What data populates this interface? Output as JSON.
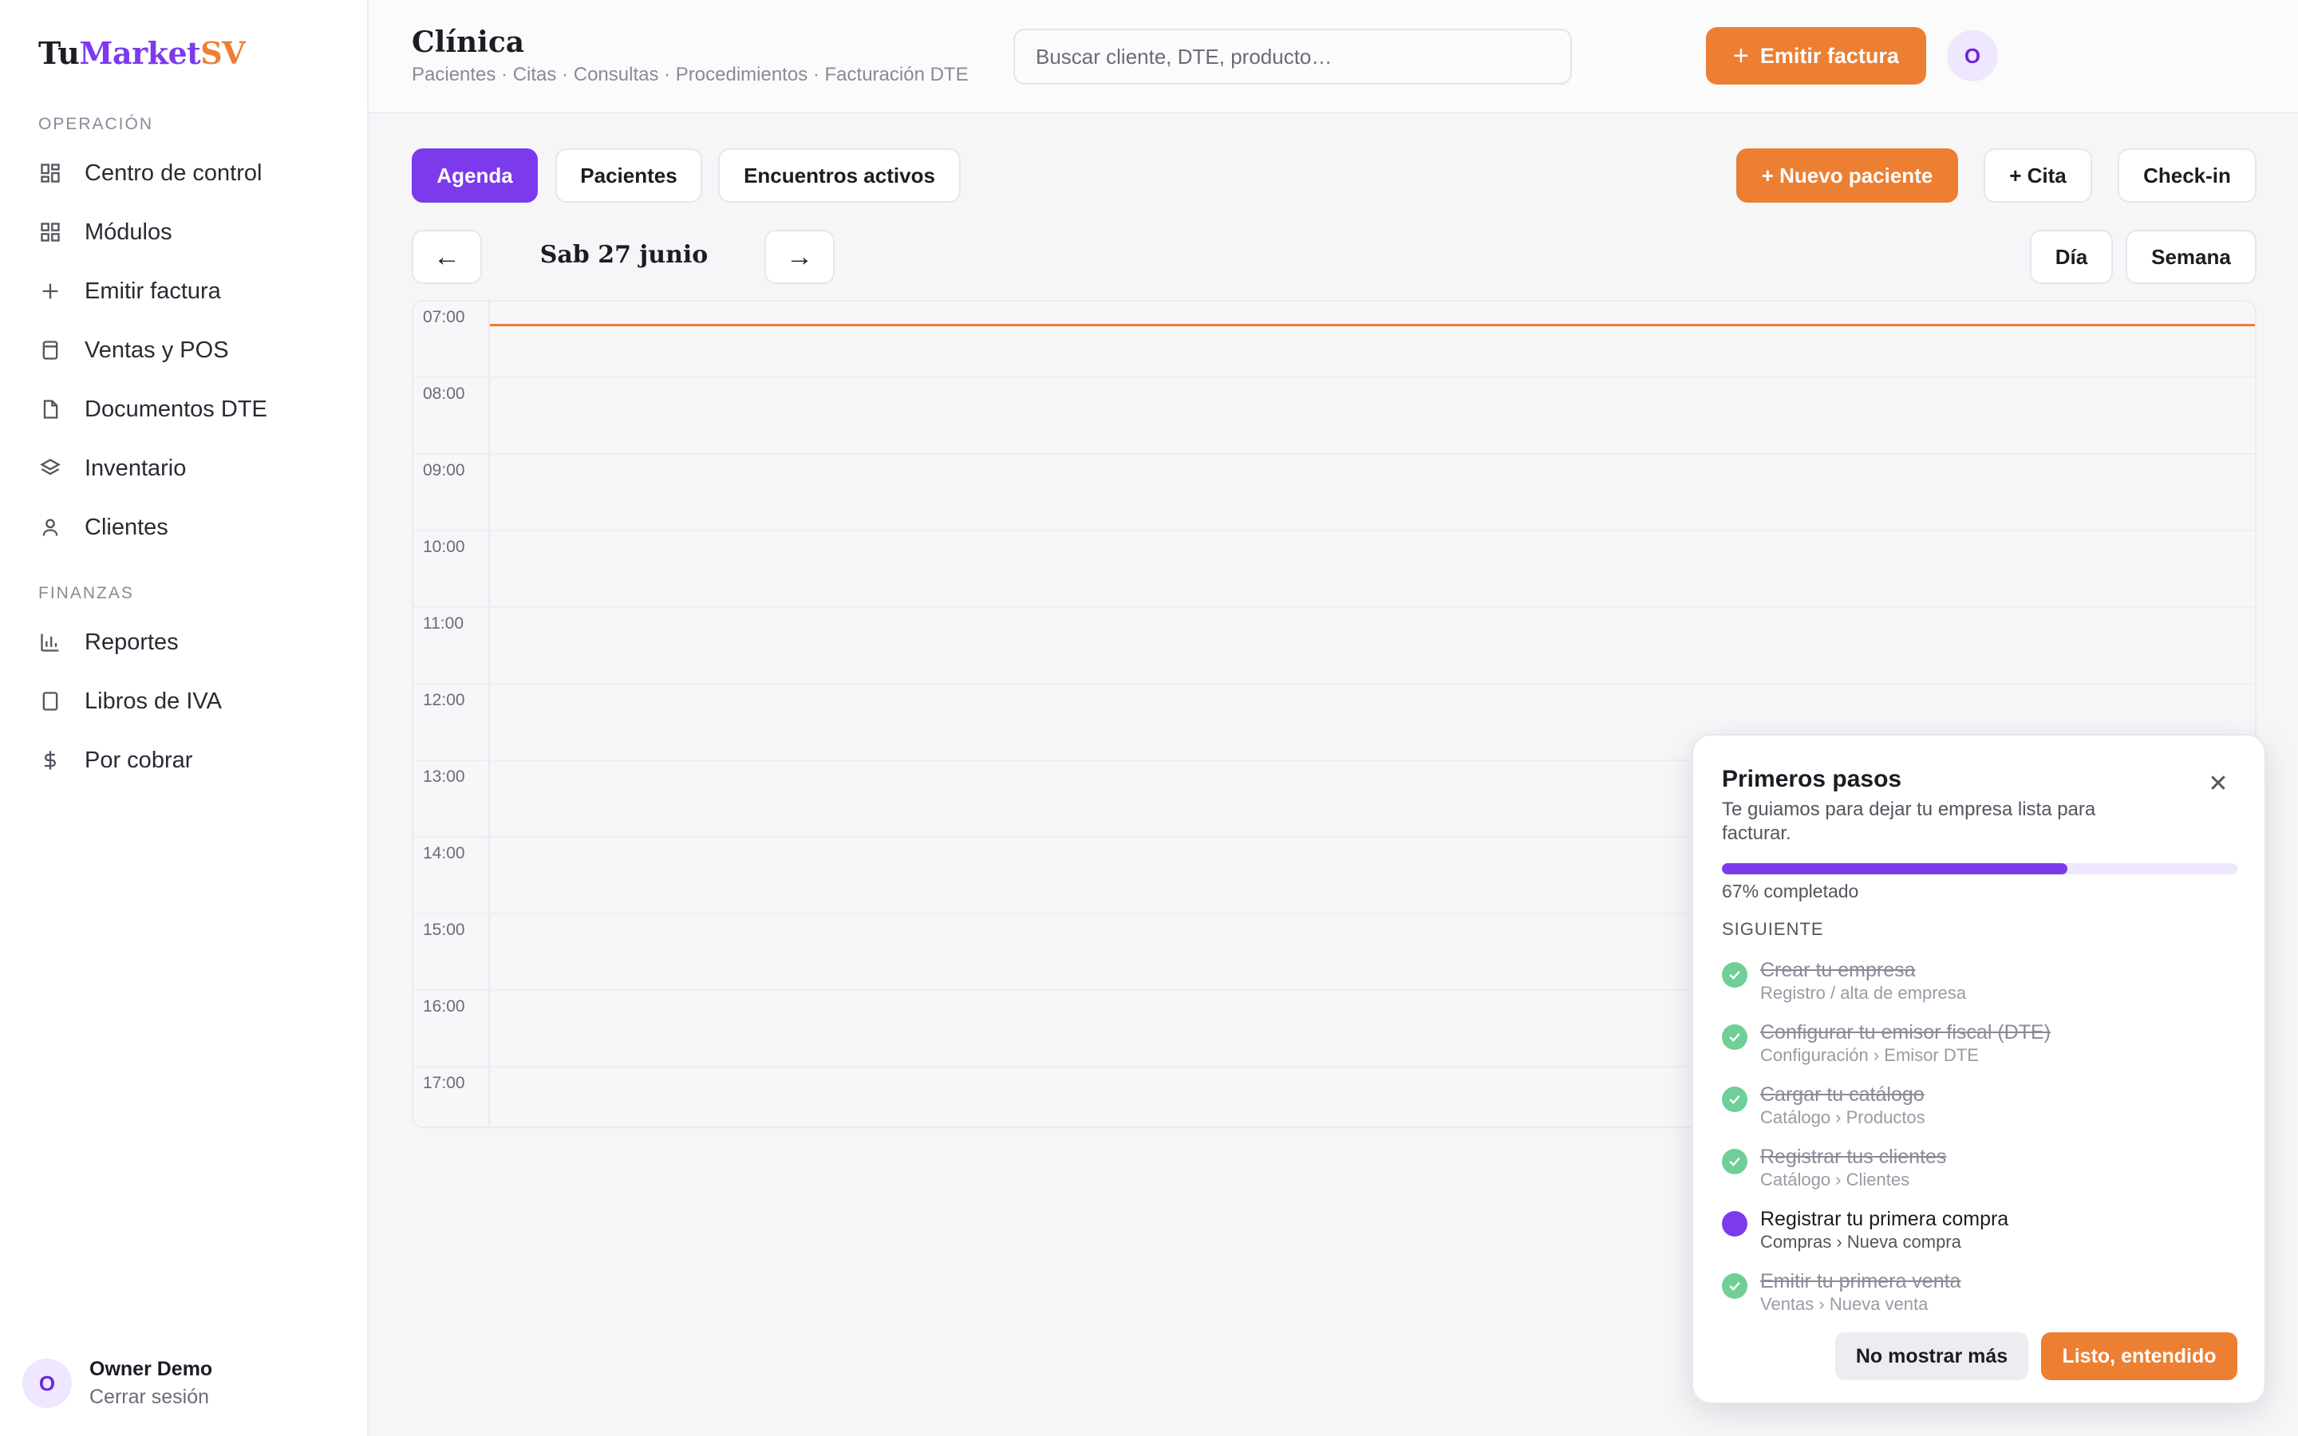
{
  "brand": {
    "part1": "Tu",
    "part2": "Market",
    "part3": "SV"
  },
  "colors": {
    "accent": "#7c3aed",
    "brand_orange": "#ec7f32",
    "success": "#6fcf97"
  },
  "sidebar": {
    "sections": [
      {
        "title": "OPERACIÓN",
        "items": [
          {
            "label": "Centro de control",
            "icon": "dashboard-icon"
          },
          {
            "label": "Módulos",
            "icon": "grid-icon"
          },
          {
            "label": "Emitir factura",
            "icon": "plus-icon"
          },
          {
            "label": "Ventas y POS",
            "icon": "register-icon"
          },
          {
            "label": "Documentos DTE",
            "icon": "document-icon"
          },
          {
            "label": "Inventario",
            "icon": "layers-icon"
          },
          {
            "label": "Clientes",
            "icon": "user-icon"
          }
        ]
      },
      {
        "title": "FINANZAS",
        "items": [
          {
            "label": "Reportes",
            "icon": "bar-chart-icon"
          },
          {
            "label": "Libros de IVA",
            "icon": "book-icon"
          },
          {
            "label": "Por cobrar",
            "icon": "dollar-icon"
          }
        ]
      }
    ],
    "user": {
      "initial": "O",
      "name": "Owner Demo",
      "logout": "Cerrar sesión"
    }
  },
  "header": {
    "title": "Clínica",
    "subtitle": "Pacientes · Citas · Consultas · Procedimientos · Facturación DTE",
    "search_placeholder": "Buscar cliente, DTE, producto…",
    "emit_button": "Emitir factura",
    "avatar_initial": "O"
  },
  "toolbar": {
    "tabs": [
      "Agenda",
      "Pacientes",
      "Encuentros activos"
    ],
    "active_tab": "Agenda",
    "new_patient": "+ Nuevo paciente",
    "new_appointment": "+ Cita",
    "checkin": "Check-in"
  },
  "date_nav": {
    "prev": "←",
    "next": "→",
    "date": "Sab 27 junio",
    "views": [
      "Día",
      "Semana"
    ]
  },
  "calendar": {
    "hours": [
      "07:00",
      "08:00",
      "09:00",
      "10:00",
      "11:00",
      "12:00",
      "13:00",
      "14:00",
      "15:00",
      "16:00",
      "17:00"
    ]
  },
  "onboarding": {
    "title": "Primeros pasos",
    "description": "Te guiamos para dejar tu empresa lista para facturar.",
    "progress": 0.67,
    "progress_label": "67% completado",
    "next_label": "SIGUIENTE",
    "steps": [
      {
        "title": "Crear tu empresa",
        "subtitle": "Registro / alta de empresa",
        "status": "done"
      },
      {
        "title": "Configurar tu emisor fiscal (DTE)",
        "subtitle": "Configuración › Emisor DTE",
        "status": "done"
      },
      {
        "title": "Cargar tu catálogo",
        "subtitle": "Catálogo › Productos",
        "status": "done"
      },
      {
        "title": "Registrar tus clientes",
        "subtitle": "Catálogo › Clientes",
        "status": "done"
      },
      {
        "title": "Registrar tu primera compra",
        "subtitle": "Compras › Nueva compra",
        "status": "current"
      },
      {
        "title": "Emitir tu primera venta",
        "subtitle": "Ventas › Nueva venta",
        "status": "done"
      }
    ],
    "dismiss_button": "No mostrar más",
    "ok_button": "Listo, entendido"
  }
}
